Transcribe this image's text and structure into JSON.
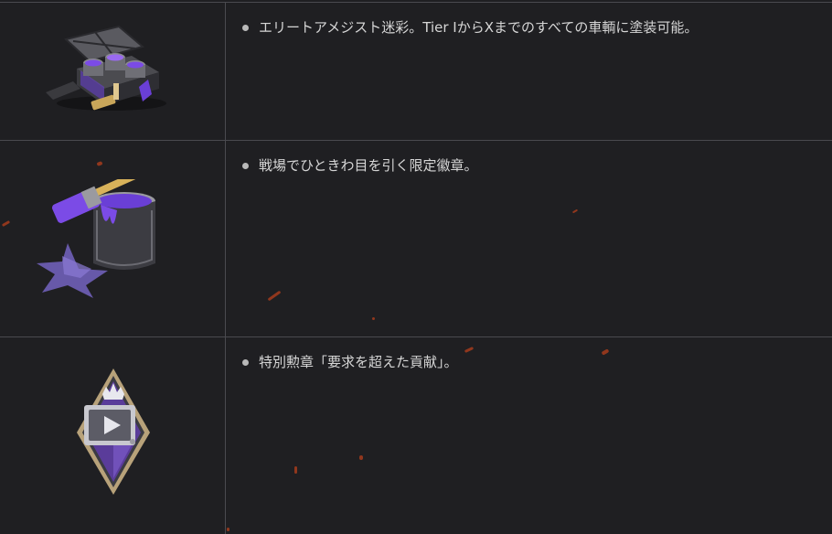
{
  "rows": [
    {
      "icon": "paint-crate-icon",
      "text": "エリートアメジスト迷彩。Tier IからXまでのすべての車輌に塗装可能。"
    },
    {
      "icon": "paint-bucket-star-icon",
      "text": "戦場でひときわ目を引く限定徽章。"
    },
    {
      "icon": "medal-diamond-icon",
      "text": "特別勲章「要求を超えた貢献」。"
    }
  ],
  "colors": {
    "background": "#1f1f22",
    "divider": "#4a4a4f",
    "text": "#d6d6d6",
    "accent_purple": "#6a3fd6",
    "spark": "#b8401c"
  }
}
